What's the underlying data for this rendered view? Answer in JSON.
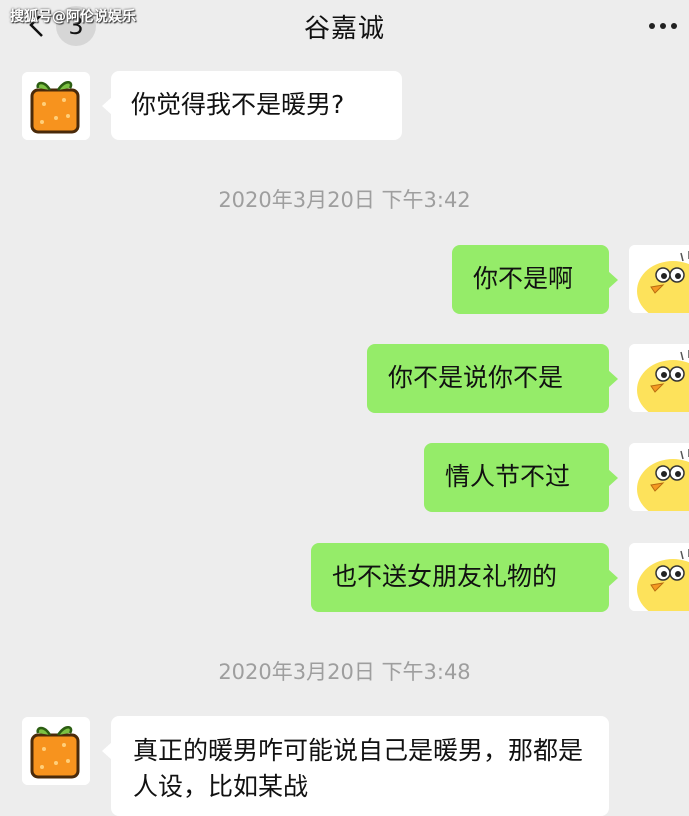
{
  "header": {
    "title": "谷嘉诚",
    "unread_count": "3",
    "watermark": "搜狐号@阿伦说娱乐"
  },
  "messages": [
    {
      "sender": "contact",
      "text": "你觉得我不是暖男?"
    },
    {
      "type": "time",
      "text": "2020年3月20日 下午3:42"
    },
    {
      "sender": "me",
      "text": "你不是啊"
    },
    {
      "sender": "me",
      "text": "你不是说你不是"
    },
    {
      "sender": "me",
      "text": "情人节不过"
    },
    {
      "sender": "me",
      "text": "也不送女朋友礼物的"
    },
    {
      "type": "time",
      "text": "2020年3月20日 下午3:48"
    },
    {
      "sender": "contact",
      "text": "真正的暖男咋可能说自己是暖男，那都是人设，比如某战"
    }
  ],
  "colors": {
    "background": "#ededed",
    "bubble_me": "#95ec69",
    "bubble_contact": "#ffffff",
    "timestamp": "#9e9e9e"
  },
  "icons": {
    "back": "chevron-left-icon",
    "more": "ellipsis-icon",
    "contact_avatar": "orange-cube-avatar",
    "my_avatar": "yellow-chick-avatar"
  }
}
